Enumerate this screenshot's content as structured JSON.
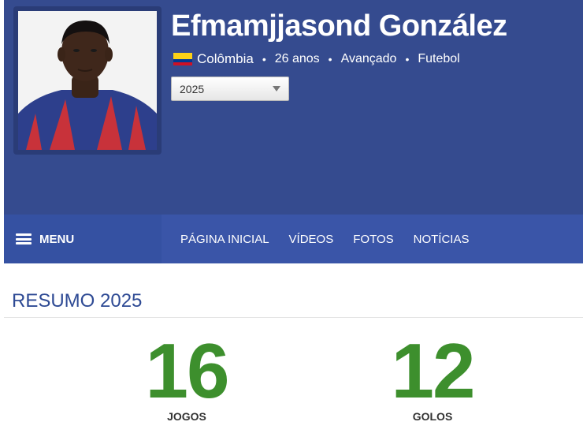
{
  "player": {
    "name": "Efmamjjasond González",
    "country": "Colômbia",
    "age": "26 anos",
    "position": "Avançado",
    "sport": "Futebol",
    "flag_colors": [
      "#fcd116",
      "#003893",
      "#ce1126"
    ]
  },
  "season_select": {
    "selected": "2025"
  },
  "nav": {
    "menu_label": "MENU",
    "links": [
      "PÁGINA INICIAL",
      "VÍDEOS",
      "FOTOS",
      "NOTÍCIAS"
    ]
  },
  "summary": {
    "title": "RESUMO 2025",
    "stats": [
      {
        "value": "16",
        "label": "JOGOS"
      },
      {
        "value": "12",
        "label": "GOLOS"
      }
    ]
  },
  "colors": {
    "header_bg": "#354b8f",
    "nav_bg": "#3a55a8",
    "stat_green": "#3d8f2d",
    "title_blue": "#2e4a94"
  }
}
